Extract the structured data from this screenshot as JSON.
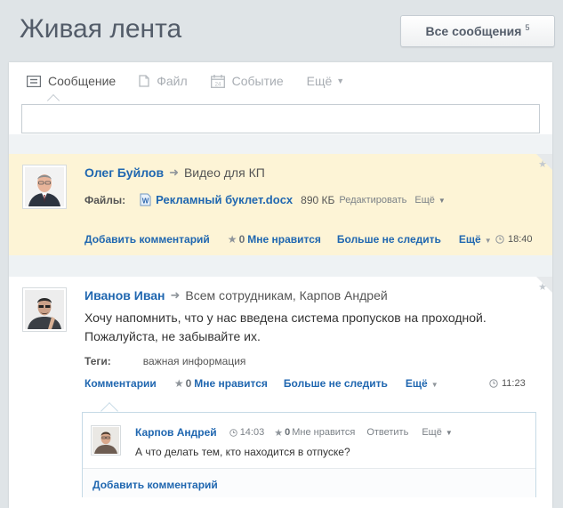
{
  "page": {
    "title": "Живая лента"
  },
  "filter": {
    "label": "Все сообщения",
    "count": "5"
  },
  "composer": {
    "tabs": [
      {
        "label": "Сообщение",
        "icon": "message-icon",
        "active": true
      },
      {
        "label": "Файл",
        "icon": "file-icon",
        "active": false
      },
      {
        "label": "Событие",
        "icon": "calendar-icon",
        "active": false
      },
      {
        "label": "Ещё",
        "icon": "chevron-down-icon",
        "active": false
      }
    ],
    "input_value": ""
  },
  "posts": [
    {
      "author": "Олег Буйлов",
      "destination": "Видео для КП",
      "files_label": "Файлы:",
      "file_name": "Рекламный буклет.docx",
      "file_size": "890 КБ",
      "file_edit": "Редактировать",
      "file_more": "Ещё",
      "actions": {
        "comment": "Добавить комментарий",
        "like_count": "0",
        "like_label": "Мне нравится",
        "unfollow": "Больше не следить",
        "more": "Ещё",
        "time": "18:40"
      },
      "highlight_color": "#fdf4d6"
    },
    {
      "author": "Иванов Иван",
      "destination": "Всем сотрудникам, Карпов Андрей",
      "text_line1": "Хочу напомнить, что у нас введена система пропусков на проходной.",
      "text_line2": "Пожалуйста, не забывайте их.",
      "tags_label": "Теги:",
      "tag": "важная информация",
      "actions": {
        "comments": "Комментарии",
        "like_count": "0",
        "like_label": "Мне нравится",
        "unfollow": "Больше не следить",
        "more": "Ещё",
        "time": "11:23"
      },
      "comment": {
        "author": "Карпов Андрей",
        "time": "14:03",
        "like_count": "0",
        "like_label": "Мне нравится",
        "reply": "Ответить",
        "more": "Ещё",
        "text": "А что делать тем, кто находится в отпуске?"
      },
      "add_comment": "Добавить комментарий"
    }
  ],
  "colors": {
    "link": "#2067b0",
    "title": "#535c69",
    "background": "#dfe4e7"
  }
}
